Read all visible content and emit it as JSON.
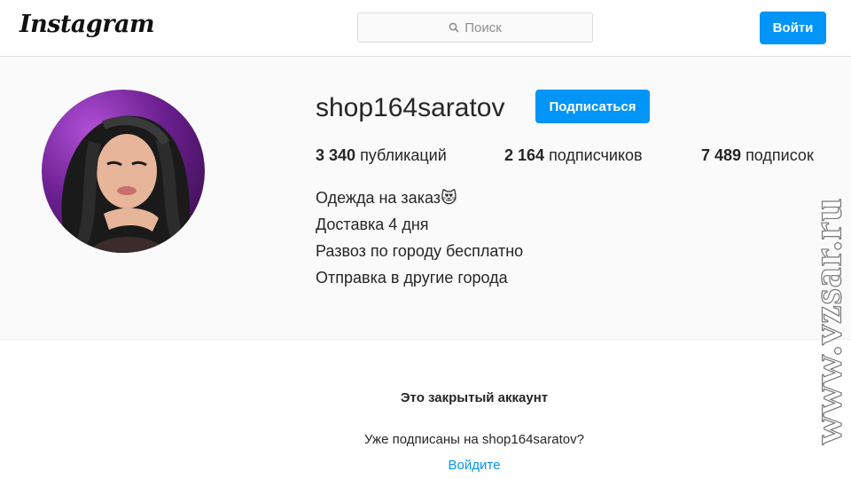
{
  "header": {
    "logo": "Instagram",
    "search_placeholder": "Поиск",
    "login_label": "Войти",
    "accent_color": "#0095f6"
  },
  "profile": {
    "username": "shop164saratov",
    "follow_label": "Подписаться",
    "stats": [
      {
        "count": "3 340",
        "label": "публикаций"
      },
      {
        "count": "2 164",
        "label": "подписчиков"
      },
      {
        "count": "7 489",
        "label": "подписок"
      }
    ],
    "bio": [
      "Одежда на заказ😻",
      "Доставка 4 дня",
      "Развоз по городу бесплатно",
      "Отправка в другие города"
    ]
  },
  "private": {
    "title": "Это закрытый аккаунт",
    "question": "Уже подписаны на shop164saratov?",
    "login_link": "Войдите"
  },
  "watermark": "www.vzsar.ru"
}
